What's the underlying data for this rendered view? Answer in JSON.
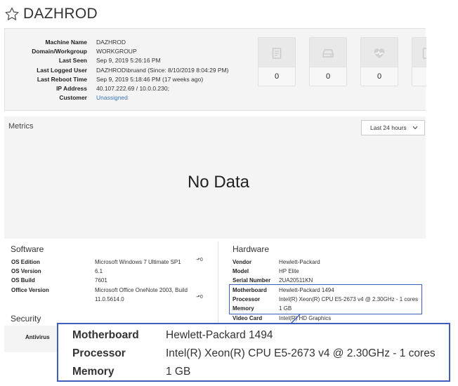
{
  "header": {
    "title": "DAZHROD"
  },
  "machine_info": [
    {
      "label": "Machine Name",
      "value": "DAZHROD"
    },
    {
      "label": "Domain/Workgroup",
      "value": "WORKGROUP"
    },
    {
      "label": "Last Seen",
      "value": "Sep 9, 2019 5:26:16 PM"
    },
    {
      "label": "Last Logged User",
      "value": "DAZHROD\\bruand (Since: 8/10/2019 8:04:29 PM)"
    },
    {
      "label": "Last Reboot Time",
      "value": "Sep 9, 2019 5:18:46 PM (17 weeks ago)"
    },
    {
      "label": "IP Address",
      "value": "40.107.222.69 / 10.0.0.230;"
    },
    {
      "label": "Customer",
      "value": "Unassigned"
    }
  ],
  "stat_cards": [
    {
      "icon": "document-icon",
      "value": "0"
    },
    {
      "icon": "drive-icon",
      "value": "0"
    },
    {
      "icon": "heartbeat-icon",
      "value": "0"
    },
    {
      "icon": "document-icon",
      "value": ""
    }
  ],
  "metrics": {
    "label": "Metrics",
    "range": "Last 24 hours",
    "empty_text": "No Data"
  },
  "software": {
    "title": "Software",
    "rows": [
      {
        "label": "OS Edition",
        "value": "Microsoft Windows 7 Ultimate SP1"
      },
      {
        "label": "OS Version",
        "value": "6.1"
      },
      {
        "label": "OS Build",
        "value": "7601"
      },
      {
        "label": "Office Version",
        "value": "Microsoft Office OneNote 2003, Build",
        "value2": "11.0.5614.0"
      }
    ]
  },
  "hardware": {
    "title": "Hardware",
    "rows": [
      {
        "label": "Vendor",
        "value": "Hewlett-Packard"
      },
      {
        "label": "Model",
        "value": "HP Elite"
      },
      {
        "label": "Serial Number",
        "value": "2UA20511KN"
      },
      {
        "label": "Motherboard",
        "value": "Hewlett-Packard 1494"
      },
      {
        "label": "Processor",
        "value": "Intel(R) Xeon(R) CPU E5-2673 v4 @ 2.30GHz - 1 cores"
      },
      {
        "label": "Memory",
        "value": "1 GB"
      },
      {
        "label": "Video Card",
        "value": "Intel(R) HD Graphics"
      }
    ]
  },
  "security": {
    "title": "Security",
    "rows": [
      {
        "label": "Antivirus",
        "value": ""
      }
    ]
  },
  "zoom": {
    "rows": [
      {
        "label": "Motherboard",
        "value": "Hewlett-Packard 1494"
      },
      {
        "label": "Processor",
        "value": "Intel(R) Xeon(R) CPU E5-2673 v4 @ 2.30GHz - 1 cores"
      },
      {
        "label": "Memory",
        "value": "1 GB"
      }
    ]
  },
  "copy_glyph": "⬏0",
  "colors": {
    "link": "#3a74b8",
    "highlight": "#3f5dbd",
    "panel": "#f4f4f4"
  }
}
